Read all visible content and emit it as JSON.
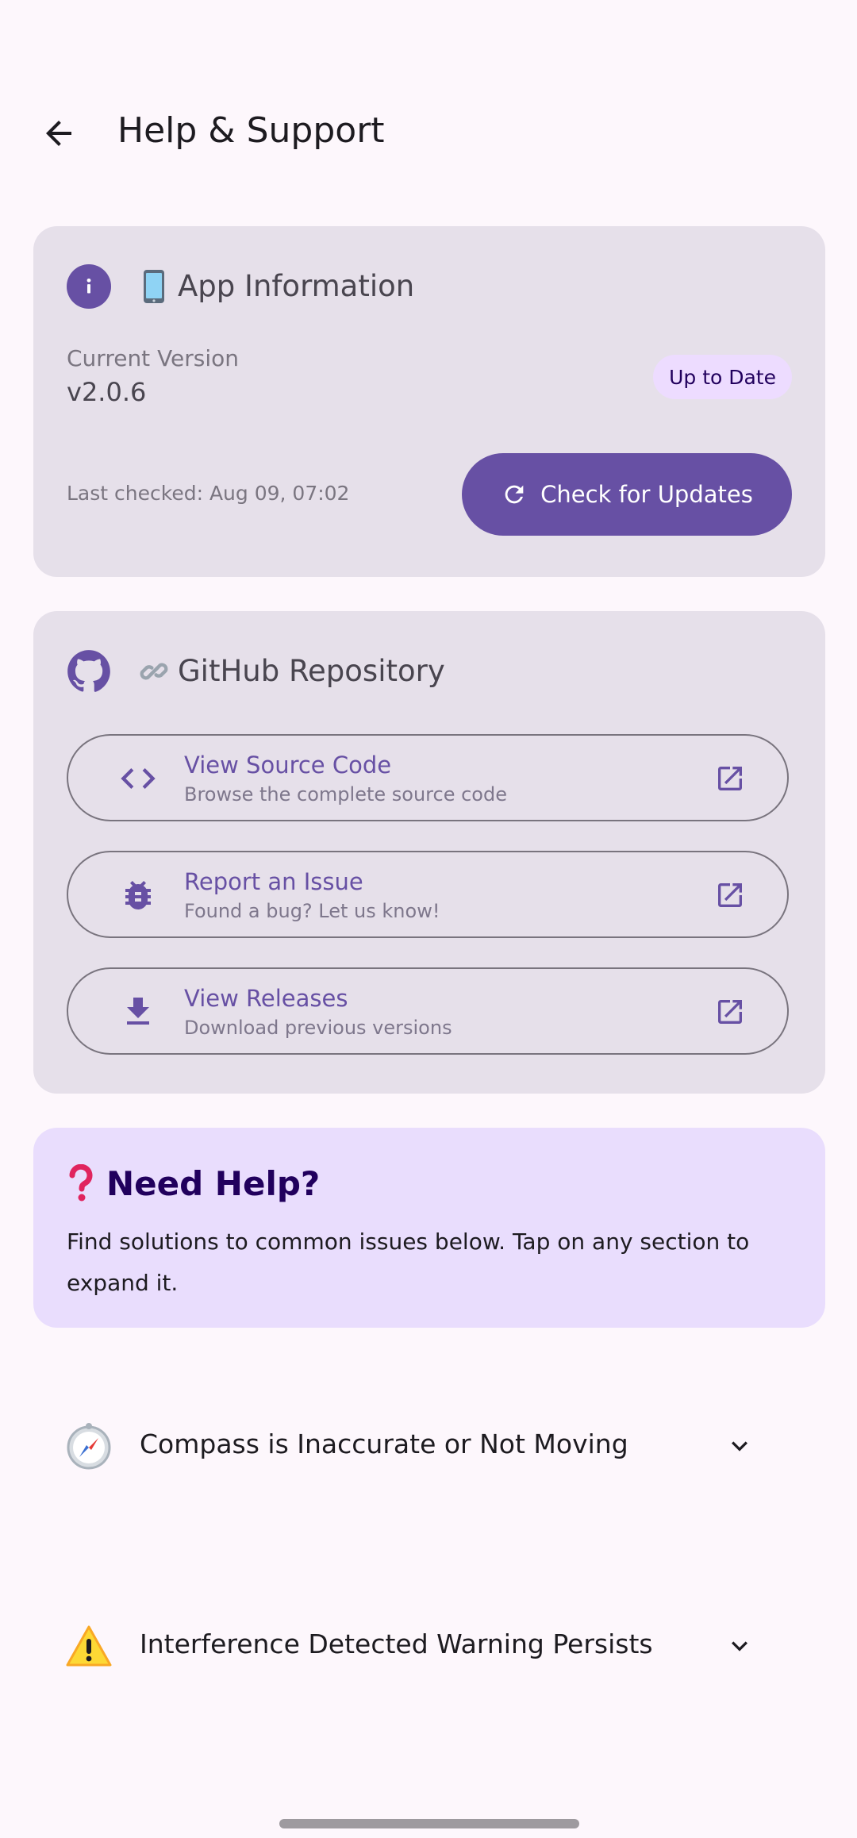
{
  "header": {
    "title": "Help & Support",
    "back_icon": "arrow-back-icon"
  },
  "app_info": {
    "title": "App Information",
    "header_icon": "info-icon",
    "title_emoji": "mobile-phone-emoji",
    "version_label": "Current Version",
    "version_value": "v2.0.6",
    "status_badge": "Up to Date",
    "last_checked": "Last checked: Aug 09, 07:02",
    "check_button": "Check for Updates",
    "check_button_icon": "refresh-icon"
  },
  "github": {
    "title": "GitHub Repository",
    "header_icon": "github-icon",
    "title_emoji": "link-emoji",
    "links": [
      {
        "title": "View Source Code",
        "subtitle": "Browse the complete source code",
        "icon": "code-icon"
      },
      {
        "title": "Report an Issue",
        "subtitle": "Found a bug? Let us know!",
        "icon": "bug-icon"
      },
      {
        "title": "View Releases",
        "subtitle": "Download previous versions",
        "icon": "download-icon"
      }
    ],
    "link_trailing_icon": "open-external-icon"
  },
  "help": {
    "title": "Need Help?",
    "title_emoji": "question-mark-emoji",
    "description": "Find solutions to common issues below. Tap on any section to expand it."
  },
  "faq": [
    {
      "label": "Compass is Inaccurate or Not Moving",
      "icon": "compass-icon"
    },
    {
      "label": "Interference Detected Warning Persists",
      "icon": "warning-icon"
    }
  ],
  "colors": {
    "background": "#fdf7fc",
    "card": "#e6e0ea",
    "help_card": "#e9ddfd",
    "primary": "#6750a4",
    "on_primary": "#ffffff",
    "badge_bg": "#eddcff"
  }
}
